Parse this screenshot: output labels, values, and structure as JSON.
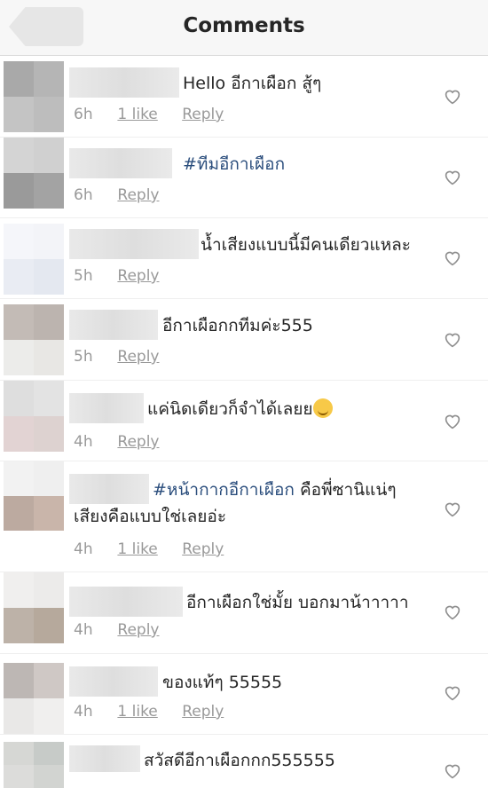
{
  "header": {
    "title": "Comments"
  },
  "comments": [
    {
      "text": "Hello อีกาเผือก สู้ๆ",
      "time": "6h",
      "likes": "1 like",
      "reply": "Reply"
    },
    {
      "hashtag": "#ทีมอีกาเผือก",
      "time": "6h",
      "reply": "Reply"
    },
    {
      "text": "น้ำเสียงแบบนี้มีคนเดียวแหละ",
      "time": "5h",
      "reply": "Reply"
    },
    {
      "text": "อีกาเผือกกทีมค่ะ555",
      "time": "5h",
      "reply": "Reply"
    },
    {
      "text": "แค่นิดเดียวก็จำได้เลยย",
      "time": "4h",
      "reply": "Reply"
    },
    {
      "hashtag": "#หน้ากากอีกาเผือก",
      "text": " คือพี่ซานิแน่ๆ",
      "text2": "เสียงคือแบบใช่เลยอ่ะ",
      "time": "4h",
      "likes": "1 like",
      "reply": "Reply"
    },
    {
      "text": "อีกาเผือกใช่มั้ย บอกมาน้าาาาา",
      "time": "4h",
      "reply": "Reply"
    },
    {
      "text": "ของแท้ๆ 55555",
      "time": "4h",
      "likes": "1 like",
      "reply": "Reply"
    },
    {
      "text": "สวัสดีอีกาเผือกกก555555"
    }
  ],
  "colors": {
    "hashtag": "#2a4d7c",
    "meta": "#999999",
    "text": "#262626"
  },
  "icons": {
    "back": "back-arrow-icon",
    "like": "heart-outline-icon",
    "emoji": "smiling-face-emoji"
  }
}
